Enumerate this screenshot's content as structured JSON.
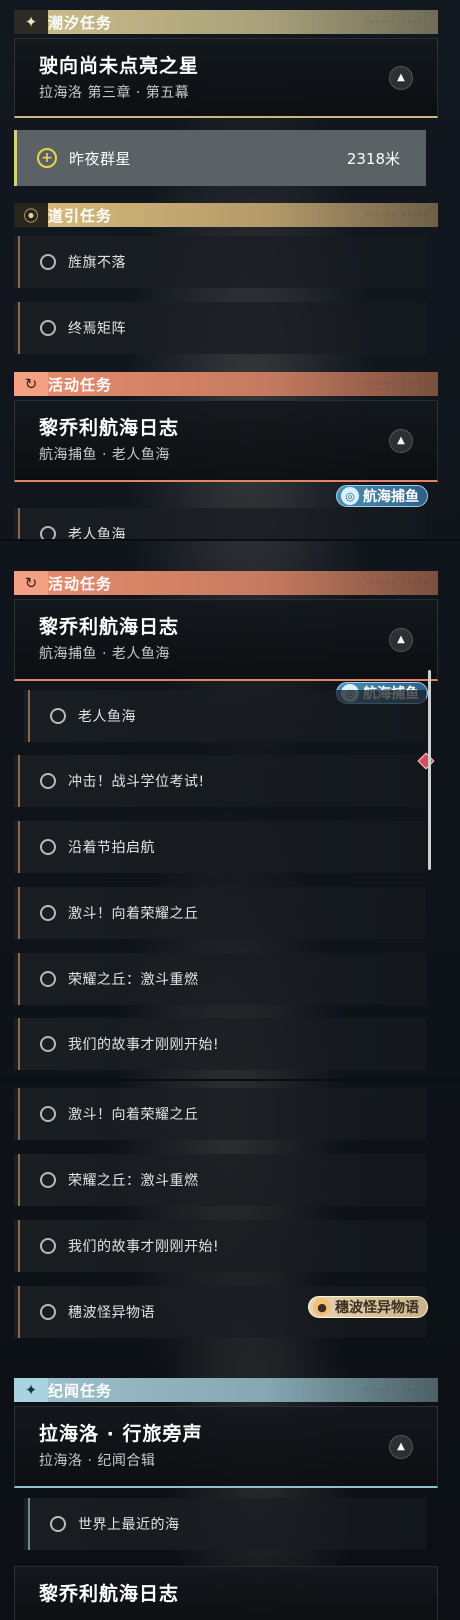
{
  "segment1": {
    "tide_header": {
      "title": "潮汐任务",
      "icon": "sparkle-icon"
    },
    "main_quest": {
      "title": "驶向尚未点亮之星",
      "subtitle": "拉海洛 第三章 · 第五幕"
    },
    "selected_step": {
      "label": "昨夜群星",
      "distance": "2318米"
    },
    "guide_header": {
      "title": "道引任务",
      "icon": "location-pin-icon"
    },
    "guide_items": [
      {
        "label": "旌旗不落"
      },
      {
        "label": "终焉矩阵"
      }
    ],
    "activity_header": {
      "title": "活动任务",
      "icon": "refresh-icon"
    },
    "activity_quest": {
      "title": "黎乔利航海日志",
      "subtitle": "航海捕鱼 · 老人鱼海"
    },
    "fishing_tag": "航海捕鱼",
    "partial_item": "老人鱼海"
  },
  "segment2": {
    "activity_header": {
      "title": "活动任务"
    },
    "activity_quest": {
      "title": "黎乔利航海日志",
      "subtitle": "航海捕鱼 · 老人鱼海"
    },
    "fishing_tag": "航海捕鱼",
    "items": [
      {
        "label": "老人鱼海"
      },
      {
        "label": "冲击！战斗学位考试!"
      },
      {
        "label": "沿着节拍启航"
      },
      {
        "label": "激斗！向着荣耀之丘"
      },
      {
        "label": "荣耀之丘：激斗重燃"
      },
      {
        "label": "我们的故事才刚刚开始!"
      }
    ]
  },
  "segment3": {
    "items": [
      {
        "label": "激斗！向着荣耀之丘"
      },
      {
        "label": "荣耀之丘：激斗重燃"
      },
      {
        "label": "我们的故事才刚刚开始!"
      },
      {
        "label": "穗波怪异物语"
      }
    ],
    "wave_tag": "穗波怪异物语",
    "lore_header": {
      "title": "纪闻任务",
      "icon": "sparkle-icon"
    },
    "lore_quest": {
      "title": "拉海洛 · 行旅旁声",
      "subtitle": "拉海洛 · 纪闻合辑"
    },
    "lore_item": "世界上最近的海",
    "partial_quest_title": "黎乔利航海日志"
  },
  "colors": {
    "tide": "#cdbf8a",
    "guide": "#d8bd7c",
    "activity": "#e98d6e",
    "lore": "#9fc3cf",
    "highlight": "#f0d24a"
  }
}
